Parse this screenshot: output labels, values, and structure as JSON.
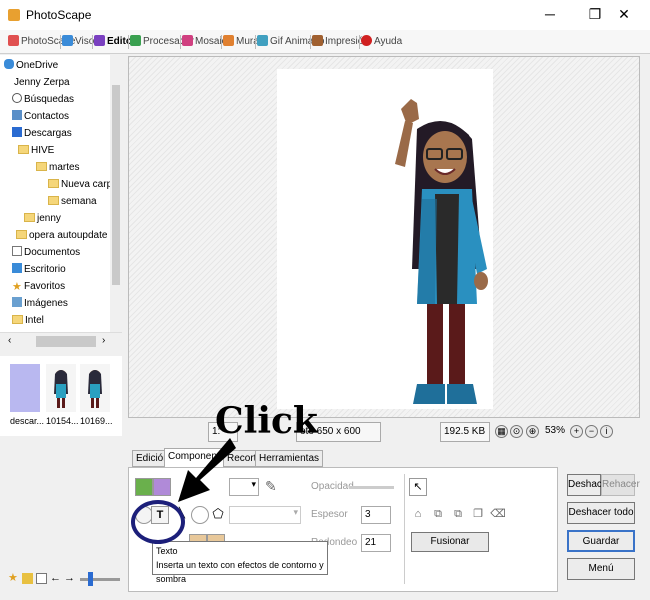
{
  "window": {
    "title": "PhotoScape",
    "minimize": "─",
    "maximize": "❐",
    "close": "✕"
  },
  "tabs": [
    {
      "label": "PhotoScape",
      "color": "#e05050"
    },
    {
      "label": "Visor",
      "color": "#3a8bd8"
    },
    {
      "label": "Editor",
      "color": "#7a40c0"
    },
    {
      "label": "Procesador",
      "color": "#3aa050"
    },
    {
      "label": "Mosaico",
      "color": "#d04080"
    },
    {
      "label": "Mural",
      "color": "#e08030"
    },
    {
      "label": "Gif Animado",
      "color": "#40a0c0"
    },
    {
      "label": "Impresión",
      "color": "#a06030"
    },
    {
      "label": "Ayuda",
      "color": "#d02020"
    }
  ],
  "tree": [
    {
      "label": "OneDrive",
      "indent": 0
    },
    {
      "label": "Jenny Zerpa",
      "indent": 0
    },
    {
      "label": "Búsquedas",
      "indent": 1
    },
    {
      "label": "Contactos",
      "indent": 1
    },
    {
      "label": "Descargas",
      "indent": 1
    },
    {
      "label": "HIVE",
      "indent": 2
    },
    {
      "label": "martes",
      "indent": 3
    },
    {
      "label": "Nueva carpeta",
      "indent": 4
    },
    {
      "label": "semana",
      "indent": 4
    },
    {
      "label": "jenny",
      "indent": 2
    },
    {
      "label": "opera autoupdate",
      "indent": 2
    },
    {
      "label": "Documentos",
      "indent": 1
    },
    {
      "label": "Escritorio",
      "indent": 1
    },
    {
      "label": "Favoritos",
      "indent": 1
    },
    {
      "label": "Imágenes",
      "indent": 1
    },
    {
      "label": "Intel",
      "indent": 1
    }
  ],
  "thumbnails": [
    {
      "caption": "descar..."
    },
    {
      "caption": "10154..."
    },
    {
      "caption": "10169..."
    }
  ],
  "status": {
    "zoom_left": "1:",
    "dimensions": "oto 650 x 600",
    "filesize": "192.5 KB",
    "zoom_percent": "53%"
  },
  "bottom_tabs": [
    "Edición",
    "Componente",
    "Recorte",
    "Herramientas"
  ],
  "panel": {
    "opacity_label": "Opacidad",
    "thickness_label": "Espesor",
    "thickness_value": "3",
    "rounding_label": "Redondeo",
    "rounding_value": "21",
    "merge_button": "Fusionar",
    "text_tool": "T"
  },
  "tooltip": {
    "title": "Texto",
    "description": "Inserta un texto con efectos de contorno y sombra"
  },
  "right_buttons": {
    "undo": "Deshacer",
    "redo": "Rehacer",
    "undo_all": "Deshacer todo",
    "save": "Guardar",
    "menu": "Menú"
  },
  "annotation": {
    "label": "Click"
  }
}
